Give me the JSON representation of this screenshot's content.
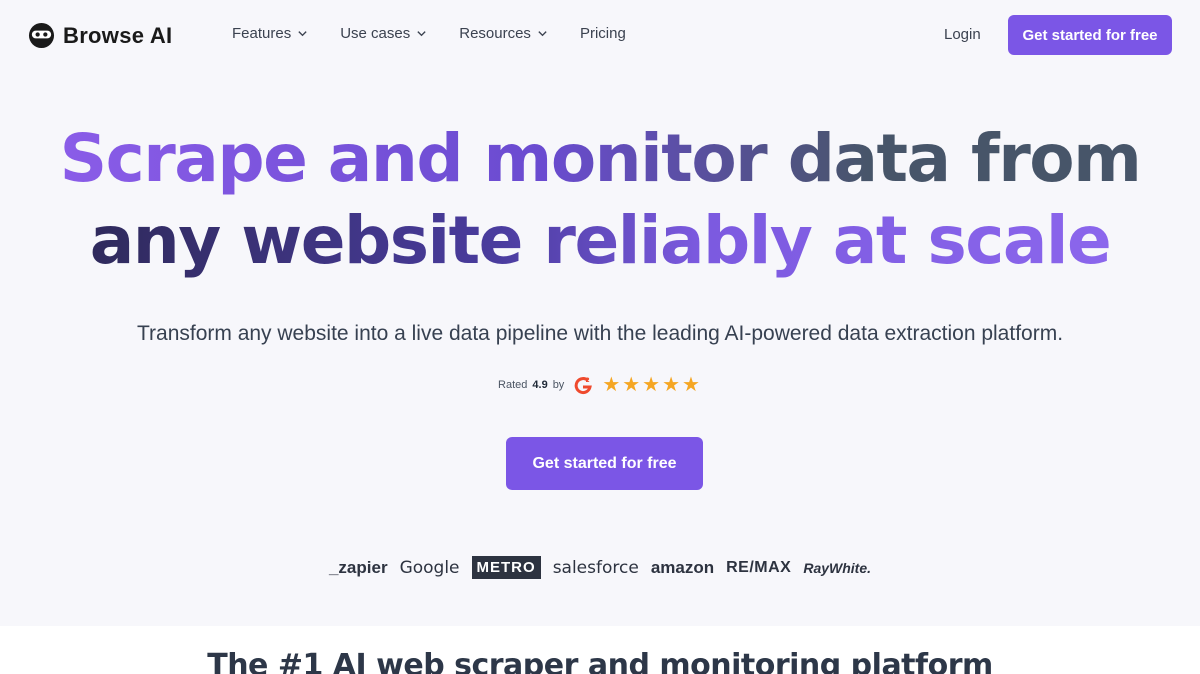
{
  "nav": {
    "brand": "Browse AI",
    "menu": [
      {
        "label": "Features",
        "has_dropdown": true
      },
      {
        "label": "Use cases",
        "has_dropdown": true
      },
      {
        "label": "Resources",
        "has_dropdown": true
      },
      {
        "label": "Pricing",
        "has_dropdown": false
      }
    ],
    "login": "Login",
    "cta": "Get started for free"
  },
  "hero": {
    "title_line1_a": "Scrape and monitor data from",
    "title_line2_a": "any website reliably at scale",
    "subtitle": "Transform any website into a live data pipeline with the leading AI-powered data extraction platform.",
    "rating_prefix": "Rated",
    "rating_value": "4.9",
    "rating_by": "by",
    "stars": "★★★★★",
    "cta": "Get started for free"
  },
  "logos": [
    "_zapier",
    "Google",
    "METRO",
    "salesforce",
    "amazon",
    "RE/MAX",
    "RayWhite."
  ],
  "section2": {
    "title": "The #1 AI web scraper and monitoring platform"
  },
  "colors": {
    "accent": "#7b56e6",
    "background": "#f7f7fb",
    "star": "#f5a623",
    "g2": "#ef4a2d"
  }
}
